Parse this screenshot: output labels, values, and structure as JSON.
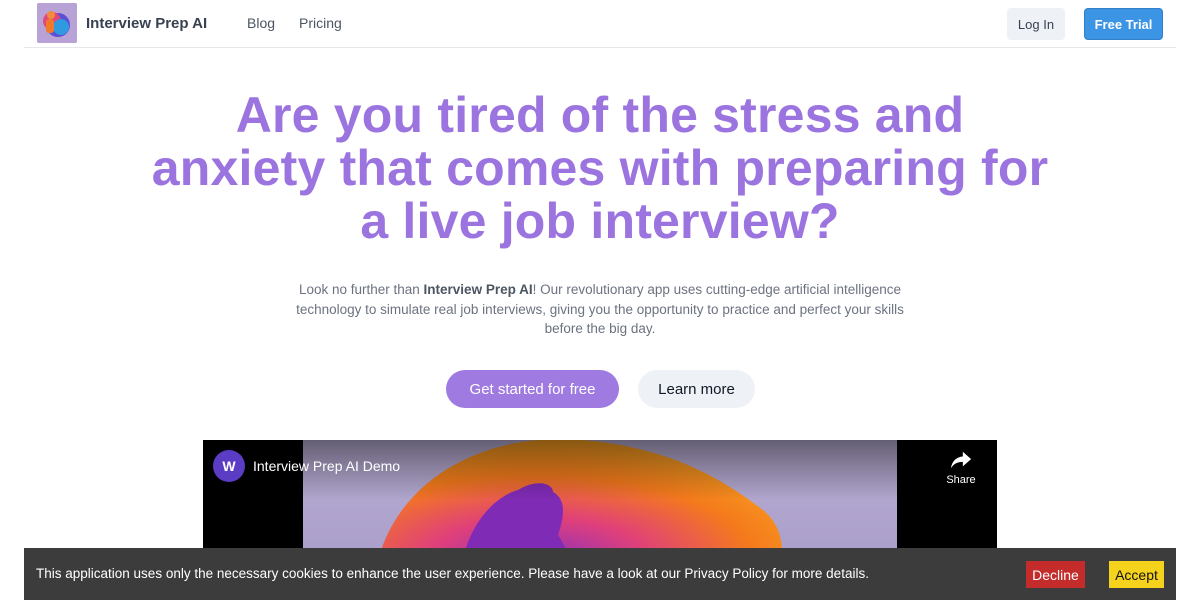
{
  "navbar": {
    "brand": "Interview Prep AI",
    "links": [
      "Blog",
      "Pricing"
    ],
    "login_label": "Log In",
    "trial_label": "Free Trial"
  },
  "hero": {
    "title": "Are you tired of the stress and anxiety that comes with preparing for a live job interview?",
    "subtitle_before": "Look no further than ",
    "subtitle_bold": "Interview Prep AI",
    "subtitle_after": "! Our revolutionary app uses cutting-edge artificial intelligence technology to simulate real job interviews, giving you the opportunity to practice and perfect your skills before the big day.",
    "primary_cta": "Get started for free",
    "secondary_cta": "Learn more"
  },
  "video": {
    "channel_initial": "W",
    "title": "Interview Prep AI Demo",
    "share_label": "Share"
  },
  "cookie_banner": {
    "message": "This application uses only the necessary cookies to enhance the user experience. Please have a look at our Privacy Policy for more details.",
    "decline_label": "Decline",
    "accept_label": "Accept"
  },
  "colors": {
    "accent_purple": "#9b74e0",
    "primary_blue": "#3b94e4",
    "decline_red": "#c42b2b",
    "accept_yellow": "#f5d31c",
    "cookie_bg": "#3c3c3c"
  },
  "icons": [
    "app-logo",
    "share-icon"
  ]
}
